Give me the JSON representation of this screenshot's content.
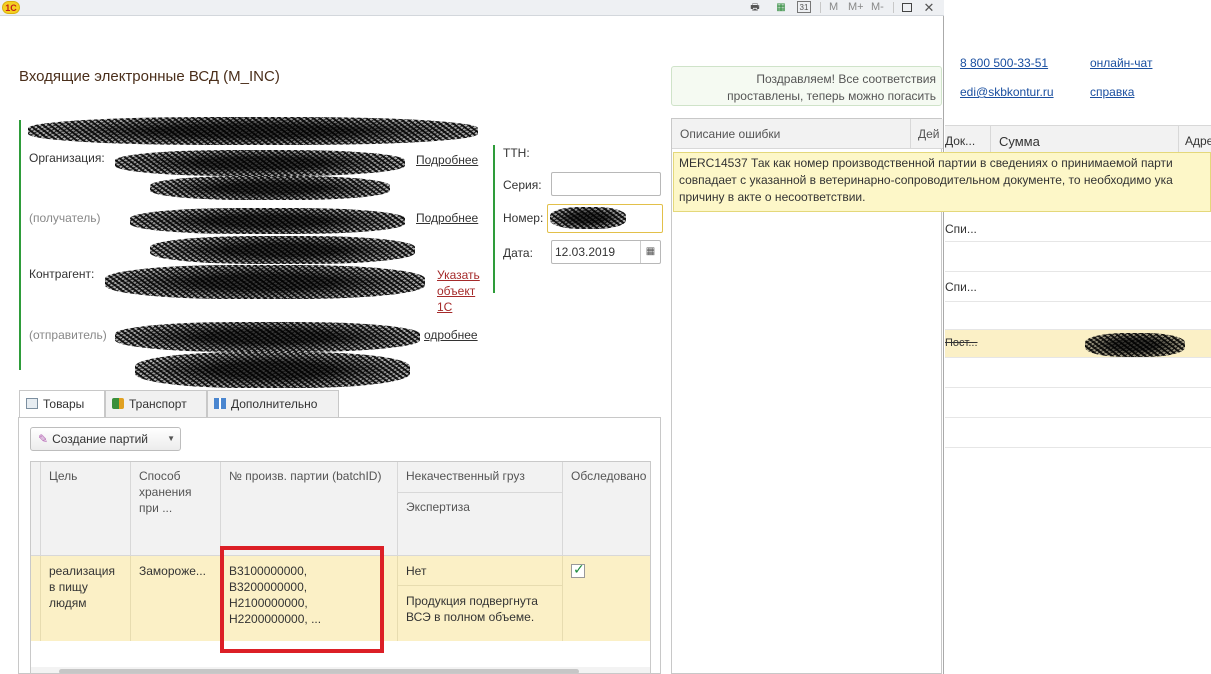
{
  "app": {
    "logo": "1С"
  },
  "toolbar": {
    "m": "M",
    "m_plus": "M+",
    "m_minus": "M-",
    "calendar_day": "31"
  },
  "document": {
    "title": "Входящие электронные ВСД (M_INC)"
  },
  "form": {
    "organization_label": "Организация:",
    "recipient_label": "(получатель)",
    "counterparty_label": "Контрагент:",
    "sender_label": "(отправитель)",
    "more_link_1": "Подробнее",
    "more_link_2": "Подробнее",
    "more_link_3": "одробнее",
    "specify_object_link_line1": "Указать",
    "specify_object_link_line2": "объект",
    "specify_object_link_line3": "1С",
    "ttn_label": "ТТН:",
    "series_label": "Серия:",
    "number_label": "Номер:",
    "date_label": "Дата:",
    "date_value": "12.03.2019",
    "series_value": ""
  },
  "tabs": [
    {
      "label": "Товары",
      "active": true
    },
    {
      "label": "Транспорт",
      "active": false
    },
    {
      "label": "Дополнительно",
      "active": false
    }
  ],
  "create_batches_button": "Создание партий",
  "grid": {
    "headers": {
      "purpose": "Цель",
      "storage": "Способ хранения при ...",
      "batch": "№ произв. партии (batchID)",
      "poor_quality": "Некачественный груз",
      "expertise": "Экспертиза",
      "examined": "Обследовано"
    },
    "row": {
      "purpose": "реализация в пищу людям",
      "storage": "Заморoже...",
      "batch_lines": [
        "B3100000000,",
        "B3200000000,",
        "H2100000000,",
        "H2200000000, ..."
      ],
      "poor_quality": "Нет",
      "expertise": "Продукция подвергнута ВСЭ в полном объеме.",
      "examined": true
    }
  },
  "notification": {
    "line1": "Поздравляем! Все соответствия",
    "line2": "проставлены, теперь можно погасить"
  },
  "error_panel": {
    "col_description": "Описание ошибки",
    "col_action": "Дей",
    "tooltip_line1": "MERC14537 Так как номер производственной партии в сведениях о принимаемой парти",
    "tooltip_line2": "совпадает с указанной в ветеринарно-сопроводительном документе, то необходимо ука",
    "tooltip_line3": "причину в акте о несоответствии."
  },
  "right_panel": {
    "phone": "8 800 500-33-51",
    "online_chat": "онлайн-чат",
    "email": "edi@skbkontur.ru",
    "help": "справка",
    "col_doc": "Док...",
    "col_sum": "Сумма",
    "col_addr": "Адре",
    "row1": "Спи...",
    "row2": "Спи...",
    "row3": "Пост..."
  },
  "colors": {
    "accent_green": "#2e9c3a",
    "highlight_red": "#dc1f26",
    "row_yellow": "#fbf0c6",
    "title_brown": "#4a2e1a"
  }
}
